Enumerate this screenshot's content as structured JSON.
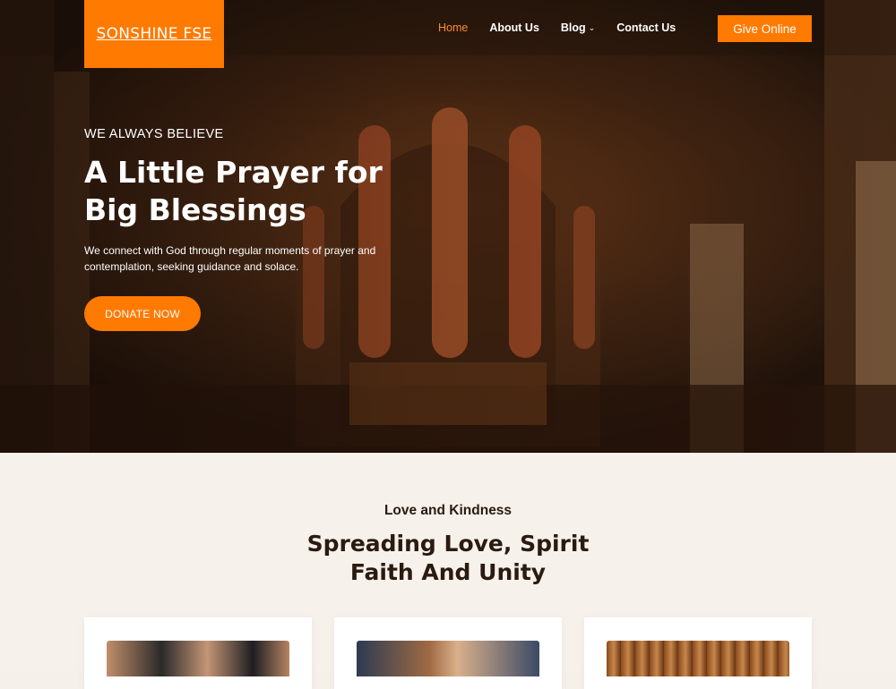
{
  "brand": {
    "name": "SONSHINE FSE",
    "color": "#ff7a00"
  },
  "nav": {
    "items": [
      {
        "label": "Home",
        "active": true
      },
      {
        "label": "About Us"
      },
      {
        "label": "Blog",
        "has_dropdown": true
      },
      {
        "label": "Contact Us"
      }
    ],
    "cta": "Give Online"
  },
  "hero": {
    "eyebrow": "WE ALWAYS BELIEVE",
    "headline_line1": "A Little Prayer for",
    "headline_line2": "Big Blessings",
    "blurb_line1": "We connect with God through regular moments of prayer and",
    "blurb_line2": "contemplation, seeking guidance and solace.",
    "button": "DONATE NOW"
  },
  "section": {
    "eyebrow": "Love and Kindness",
    "title_line1": "Spreading Love, Spirit",
    "title_line2": "Faith And Unity"
  },
  "icons": {
    "blog_dropdown": "chevron-down-icon"
  }
}
